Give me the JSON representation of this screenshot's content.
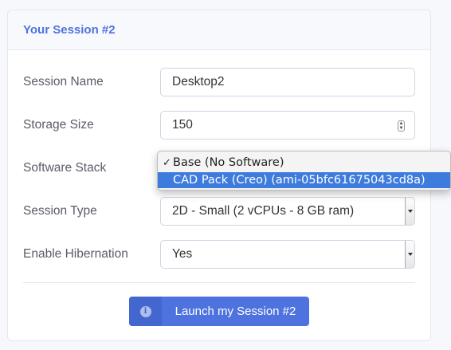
{
  "header": {
    "title": "Your Session #2"
  },
  "form": {
    "session_name": {
      "label": "Session Name",
      "value": "Desktop2"
    },
    "storage_size": {
      "label": "Storage Size",
      "value": "150"
    },
    "software_stack": {
      "label": "Software Stack",
      "options": [
        {
          "label": "Base (No Software)",
          "checked": true
        },
        {
          "label": "CAD Pack (Creo) (ami-05bfc61675043cd8a)",
          "highlighted": true
        }
      ]
    },
    "session_type": {
      "label": "Session Type",
      "value": "2D - Small (2 vCPUs - 8 GB ram)"
    },
    "enable_hibernation": {
      "label": "Enable Hibernation",
      "value": "Yes"
    }
  },
  "launch_button": {
    "label": "Launch my Session #2",
    "icon": "info-icon",
    "icon_glyph": "i"
  },
  "icons": {
    "check": "✓"
  },
  "colors": {
    "accent": "#4e73df",
    "highlight": "#3d7bdc"
  }
}
